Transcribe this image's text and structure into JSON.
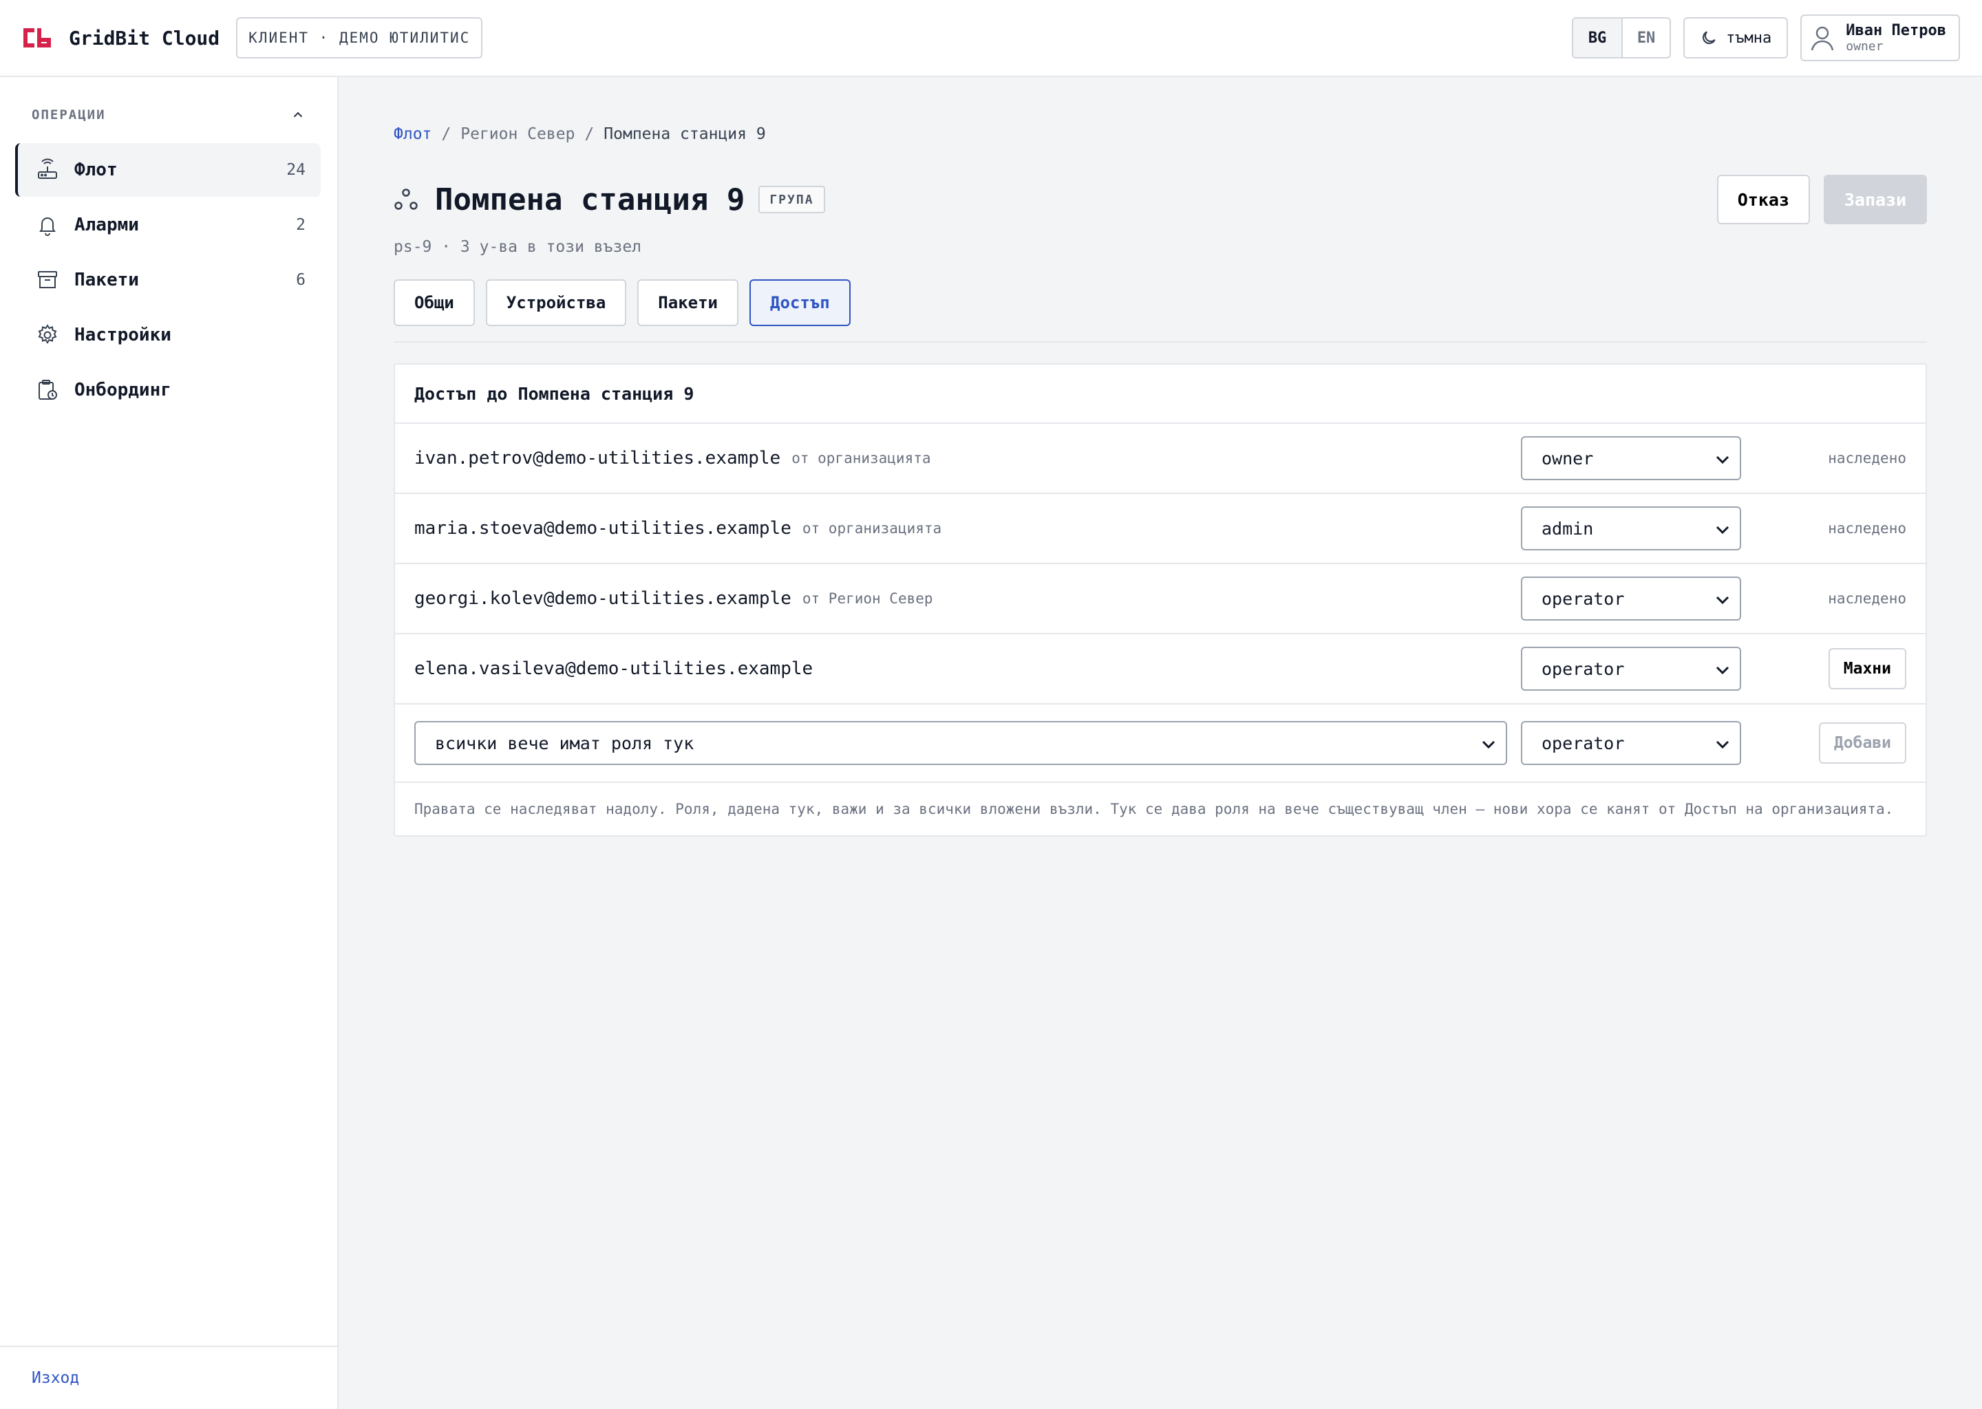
{
  "header": {
    "app_name": "GridBit Cloud",
    "tenant": "КЛИЕНТ · ДЕМО ЮТИЛИТИС",
    "languages": [
      "BG",
      "EN"
    ],
    "active_language": "BG",
    "theme_label": "тъмна",
    "user": {
      "name": "Иван Петров",
      "role": "owner"
    }
  },
  "colors": {
    "brand": "#d6214a",
    "accent": "#2f55c3"
  },
  "sidebar": {
    "section_title": "ОПЕРАЦИИ",
    "items": [
      {
        "label": "Флот",
        "count": "24",
        "icon": "router-icon",
        "active": true
      },
      {
        "label": "Аларми",
        "count": "2",
        "icon": "bell-icon"
      },
      {
        "label": "Пакети",
        "count": "6",
        "icon": "archive-icon"
      },
      {
        "label": "Настройки",
        "count": "",
        "icon": "gear-icon"
      },
      {
        "label": "Онбординг",
        "count": "",
        "icon": "clipboard-clock-icon"
      }
    ],
    "logout": "Изход"
  },
  "main": {
    "breadcrumb": [
      "Флот",
      "Регион Север",
      "Помпена станция 9"
    ],
    "title": "Помпена станция 9",
    "badge": "ГРУПА",
    "subline": "ps-9 · 3 у-ва в този възел",
    "cancel_label": "Отказ",
    "save_label": "Запази",
    "tabs": [
      "Общи",
      "Устройства",
      "Пакети",
      "Достъп"
    ],
    "active_tab": "Достъп"
  },
  "access": {
    "heading": "Достъп до Помпена станция 9",
    "members": [
      {
        "email": "ivan.petrov@demo-utilities.example",
        "origin": "от организацията",
        "role": "owner",
        "status": "наследено"
      },
      {
        "email": "maria.stoeva@demo-utilities.example",
        "origin": "от организацията",
        "role": "admin",
        "status": "наследено"
      },
      {
        "email": "georgi.kolev@demo-utilities.example",
        "origin": "от Регион Север",
        "role": "operator",
        "status": "наследено"
      },
      {
        "email": "elena.vasileva@demo-utilities.example",
        "origin": "",
        "role": "operator",
        "action": "Махни"
      }
    ],
    "add": {
      "member_placeholder": "всички вече имат роля тук",
      "role": "operator",
      "button": "Добави"
    },
    "note": "Правата се наследяват надолу. Роля, дадена тук, важи и за всички вложени възли. Тук се дава роля на вече съществуващ член — нови хора се канят от Достъп на организацията."
  }
}
